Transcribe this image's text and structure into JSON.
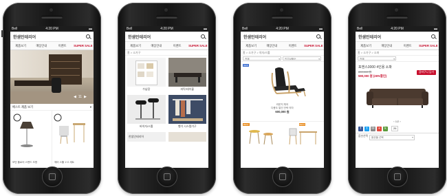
{
  "shared": {
    "carrier": "Bell",
    "time": "4:20 PM",
    "logo": "한샘인테리어",
    "menu": [
      "제품보기",
      "매장안내",
      "이벤트",
      "SUPER SALE"
    ]
  },
  "screen1": {
    "hero_pager": "11",
    "section_title": "베스트 제품 보기",
    "products": [
      {
        "name": "모던 플로어 스탠드 조명"
      },
      {
        "name": "체어 스툴 1+2 세트"
      }
    ]
  },
  "screen2": {
    "breadcrumb": "홈 > 소가구",
    "categories": [
      {
        "label": "수납장"
      },
      {
        "label": "좌탁/테이블"
      },
      {
        "label": "바의자/스툴"
      },
      {
        "label": "행거 시스템가구"
      },
      {
        "label": "한샘인테리어"
      },
      {
        "label": ""
      }
    ]
  },
  "screen3": {
    "breadcrumb": "홈 > 소가구 > 의자/스툴",
    "filter_1": "전체",
    "filter_2": "인기상품순",
    "badge_new": "NEW",
    "badge_best": "BEST",
    "item": {
      "name_line1": "라운지 체어",
      "name_line2": "다용도 일인 안락 의자",
      "price": "600,000 원"
    }
  },
  "screen4": {
    "breadcrumb": "홈 > 소가구 > 소파",
    "filter": "전체",
    "title": "포엔스3000 4인용 소파",
    "price_original": "800,000 원",
    "price_sale": "590,000 원 (26%할인)",
    "cart_button": "장바구니 담기",
    "pager": "1/2",
    "likes": "26",
    "option_label": "옵션선택",
    "option_placeholder": "옵션을 선택"
  },
  "colors": {
    "accent": "#c8102e",
    "new_badge": "#3b6dd0",
    "best_badge": "#e88a1b"
  }
}
